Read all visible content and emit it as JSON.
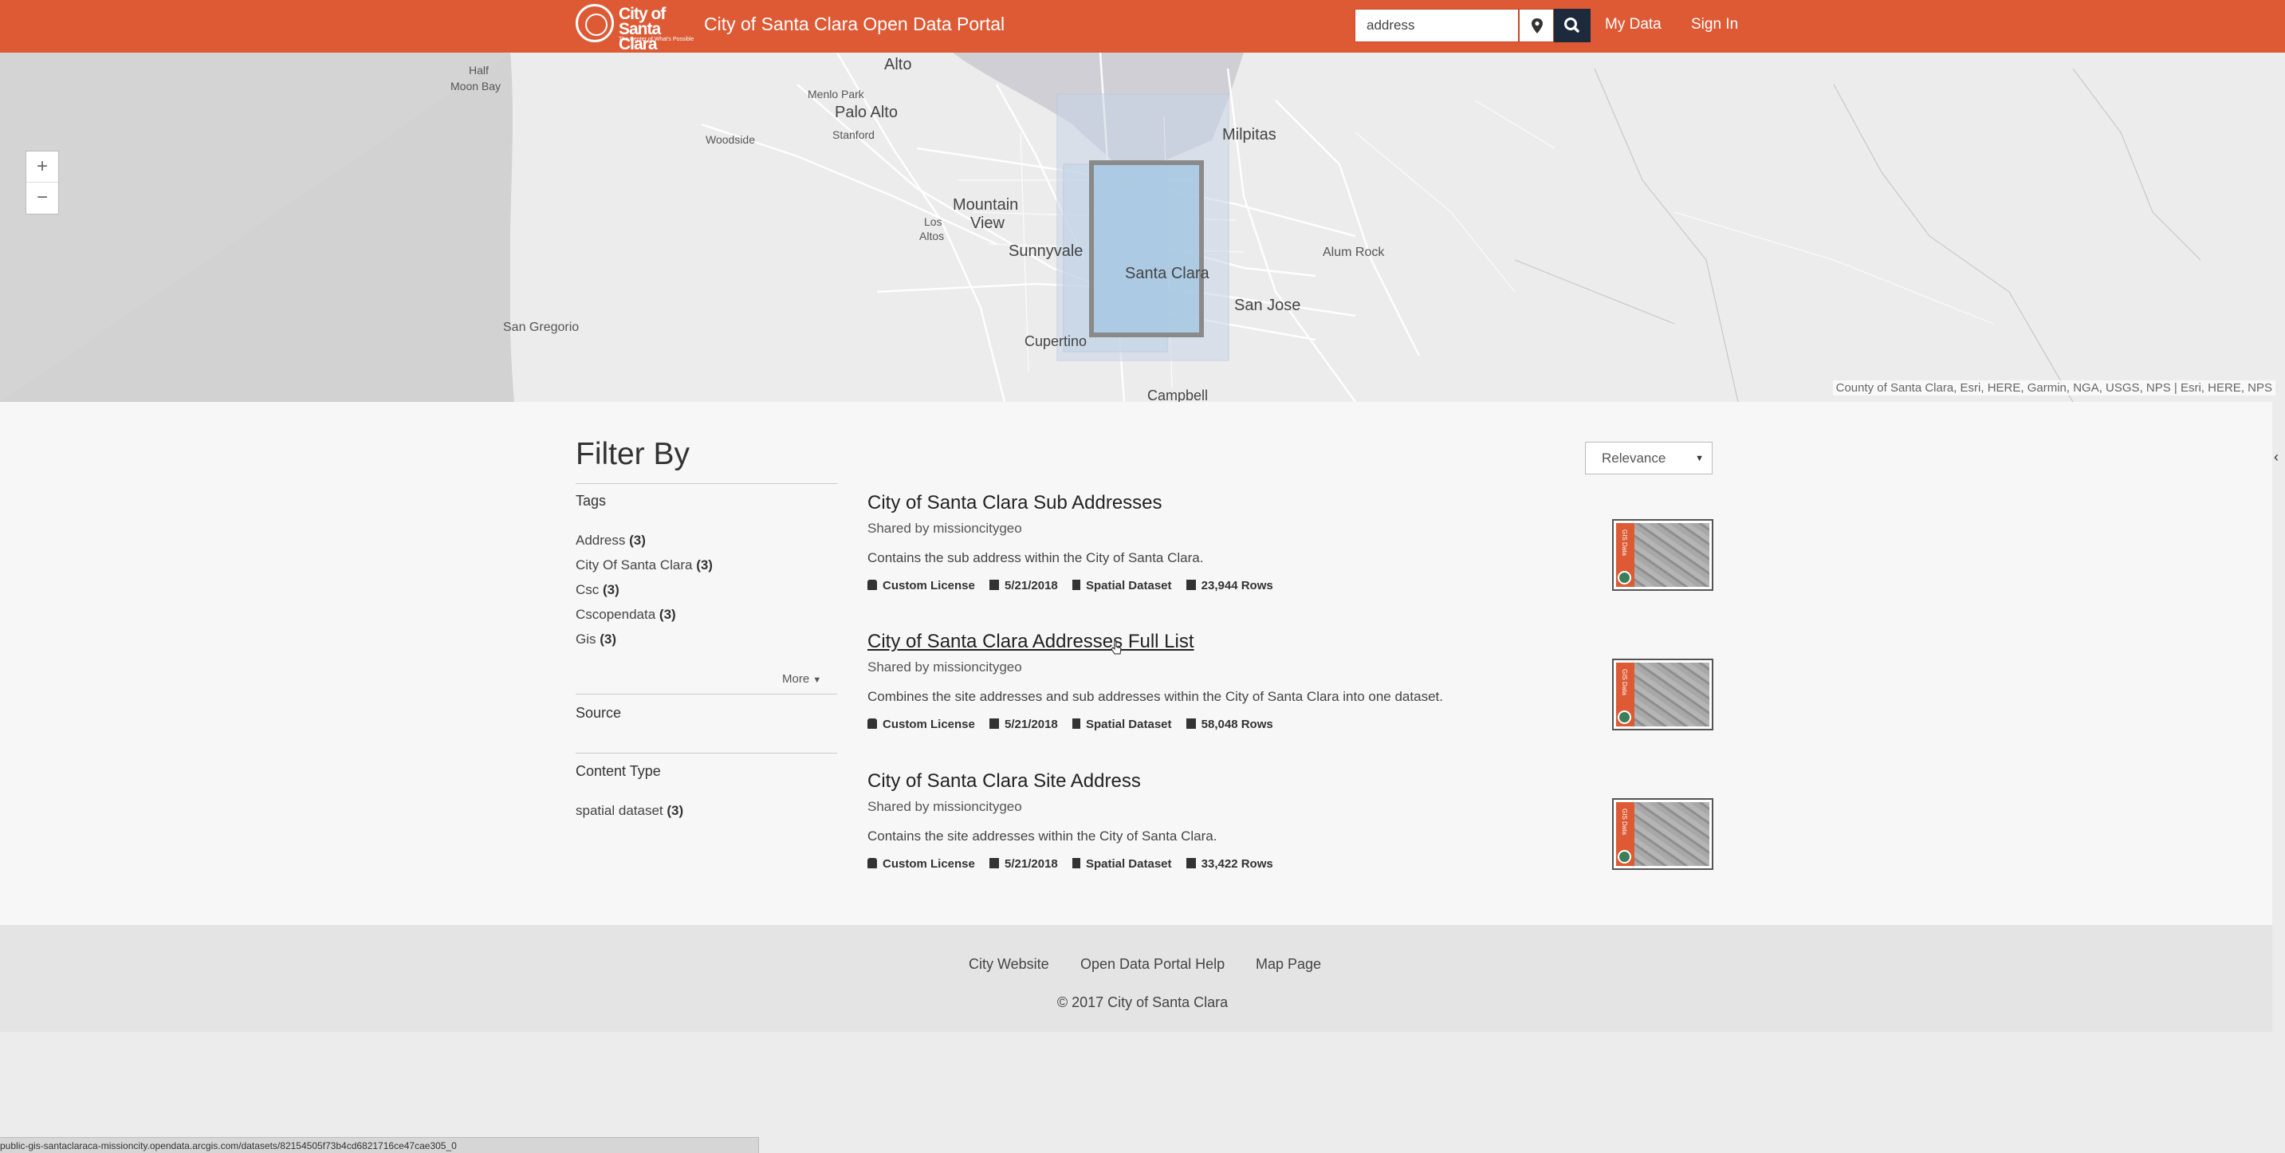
{
  "header": {
    "logo_line1": "City of",
    "logo_line2": "Santa Clara",
    "logo_sub": "The Center of What's Possible",
    "site_title": "City of Santa Clara Open Data Portal",
    "search_value": "address",
    "nav": {
      "my_data": "My Data",
      "sign_in": "Sign In"
    },
    "accent_color": "#dd5a35"
  },
  "map": {
    "zoom_in": "+",
    "zoom_out": "−",
    "labels": {
      "half_moon_bay_1": "Half",
      "half_moon_bay_2": "Moon Bay",
      "alto": "Alto",
      "menlo_park": "Menlo Park",
      "palo_alto": "Palo Alto",
      "stanford": "Stanford",
      "woodside": "Woodside",
      "milpitas": "Milpitas",
      "mountain_view_1": "Mountain",
      "mountain_view_2": "View",
      "los_altos_1": "Los",
      "los_altos_2": "Altos",
      "sunnyvale": "Sunnyvale",
      "santa_clara": "Santa Clara",
      "alum_rock": "Alum Rock",
      "san_jose": "San Jose",
      "san_gregorio": "San Gregorio",
      "cupertino": "Cupertino",
      "campbell": "Campbell"
    },
    "attribution": "County of Santa Clara, Esri, HERE, Garmin, NGA, USGS, NPS | Esri, HERE, NPS"
  },
  "filters": {
    "title": "Filter By",
    "tags_heading": "Tags",
    "tags": [
      {
        "label": "Address",
        "count": "(3)"
      },
      {
        "label": "City Of Santa Clara",
        "count": "(3)"
      },
      {
        "label": "Csc",
        "count": "(3)"
      },
      {
        "label": "Cscopendata",
        "count": "(3)"
      },
      {
        "label": "Gis",
        "count": "(3)"
      }
    ],
    "more": "More",
    "source_heading": "Source",
    "content_type_heading": "Content Type",
    "content_types": [
      {
        "label": "spatial dataset",
        "count": "(3)"
      }
    ]
  },
  "sort": {
    "selected": "Relevance"
  },
  "results": [
    {
      "title": "City of Santa Clara Sub Addresses",
      "shared_by": "Shared by missioncitygeo",
      "description": "Contains the sub address within the City of Santa Clara.",
      "license": "Custom License",
      "date": "5/21/2018",
      "type": "Spatial Dataset",
      "rows": "23,944 Rows",
      "thumb_text": "GIS Data"
    },
    {
      "title": "City of Santa Clara Addresses Full List",
      "shared_by": "Shared by missioncitygeo",
      "description": "Combines the site addresses and sub addresses within the City of Santa Clara into one dataset.",
      "license": "Custom License",
      "date": "5/21/2018",
      "type": "Spatial Dataset",
      "rows": "58,048 Rows",
      "thumb_text": "GIS Data"
    },
    {
      "title": "City of Santa Clara Site Address",
      "shared_by": "Shared by missioncitygeo",
      "description": "Contains the site addresses within the City of Santa Clara.",
      "license": "Custom License",
      "date": "5/21/2018",
      "type": "Spatial Dataset",
      "rows": "33,422 Rows",
      "thumb_text": "GIS Data"
    }
  ],
  "footer": {
    "links": [
      "City Website",
      "Open Data Portal Help",
      "Map Page"
    ],
    "copyright": "© 2017 City of Santa Clara"
  },
  "status_bar": "public-gis-santaclaraca-missioncity.opendata.arcgis.com/datasets/82154505f73b4cd6821716ce47cae305_0"
}
